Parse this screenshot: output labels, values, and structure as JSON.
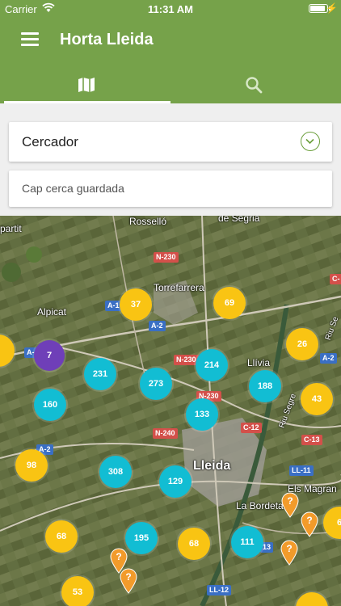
{
  "status_bar": {
    "carrier": "Carrier",
    "time": "11:31 AM"
  },
  "header": {
    "title": "Horta Lleida"
  },
  "tabs": [
    {
      "icon": "map-icon"
    },
    {
      "icon": "search-icon"
    }
  ],
  "finder": {
    "label": "Cercador",
    "expand_icon": "chevron-down-icon"
  },
  "saved_search": {
    "label": "Cap cerca guardada"
  },
  "map": {
    "places": {
      "rossello": "Rosselló",
      "segria": "de Segrià",
      "partit": "partit",
      "torrefarrera": "Torrefarrera",
      "alpicat": "Alpicat",
      "llivia": "Llívia",
      "lleida": "Lleida",
      "magrana": "Els Magran",
      "bordeta": "La Bordeta",
      "riu_segre": "Riu Segre",
      "riu_se": "Riu Se"
    },
    "roads": {
      "n230_top": "N-230",
      "a1": "A-1",
      "a2_top": "A-2",
      "a_left": "A-",
      "n230_mid": "N-230",
      "n230_mid2": "N-230",
      "a2_right": "A-2",
      "c12": "C-12",
      "c13": "C-13",
      "n240": "N-240",
      "a2_left": "A-2",
      "ll11": "LL-11",
      "ll12": "LL-12",
      "r13": "13",
      "c_edge": "C-"
    },
    "clusters": [
      {
        "count": "37"
      },
      {
        "count": "69"
      },
      {
        "count": "7"
      },
      {
        "count": "26"
      },
      {
        "count": "214"
      },
      {
        "count": "231"
      },
      {
        "count": "273"
      },
      {
        "count": "188"
      },
      {
        "count": "43"
      },
      {
        "count": "160"
      },
      {
        "count": "133"
      },
      {
        "count": "98"
      },
      {
        "count": "308"
      },
      {
        "count": "129"
      },
      {
        "count": "68"
      },
      {
        "count": "195"
      },
      {
        "count": "68"
      },
      {
        "count": "111"
      },
      {
        "count": "53"
      },
      {
        "count": "6"
      }
    ],
    "pin_label": "?"
  },
  "colors": {
    "header": "#76a24a",
    "cluster_cyan": "#12bdd3",
    "cluster_yellow": "#f9c413",
    "cluster_purple": "#6f3fb8",
    "pin_orange": "#f29b2b"
  }
}
